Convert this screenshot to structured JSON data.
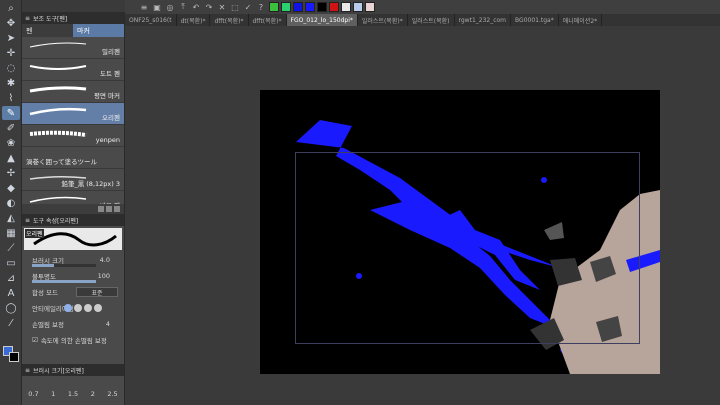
{
  "sub_tool": {
    "header": "보조 도구[펜]",
    "tabs": [
      "펜",
      "마커"
    ],
    "brushes": [
      {
        "name": "밀리펜"
      },
      {
        "name": "도트 펜"
      },
      {
        "name": "평면 마커"
      },
      {
        "name": "오리펜"
      },
      {
        "name": "yenpen"
      },
      {
        "name": "渦巻く囲って塗るツール"
      },
      {
        "name": "鉛筆_黒 (8,12px) 3"
      },
      {
        "name": "바끄 펜"
      }
    ]
  },
  "tool_property": {
    "header": "도구 속성[오리펜]",
    "preview_label": "오리펜",
    "brush_size_label": "브러시 크기",
    "brush_size_value": "4.0",
    "opacity_label": "불투명도",
    "opacity_value": "100",
    "opacity_fraction": 1.0,
    "brush_size_fraction": 0.35,
    "blend_label": "합성 모드",
    "blend_value": "표준",
    "antialias_label": "안티에일리어싱",
    "stabilization_label": "손떨림 보정",
    "stabilization_value": "4",
    "speed_label": "속도에 의한 손떨림 보정"
  },
  "brush_size_panel": {
    "header": "브러시 크기[오리펜]",
    "sizes": [
      "0.7",
      "1",
      "1.5",
      "2",
      "2.5"
    ]
  },
  "command_bar": {
    "colors": [
      "#3cbf3c",
      "#2bcf6e",
      "#1414e0",
      "#1a1aff",
      "#000000",
      "#d01414",
      "#e8e8e8",
      "#b8ccec",
      "#e8d4d4"
    ]
  },
  "document_tabs": [
    {
      "label": "ONF25_s016(t",
      "active": false
    },
    {
      "label": "dt(목환)*",
      "active": false
    },
    {
      "label": "dfft(목환)*",
      "active": false
    },
    {
      "label": "dfft(목환)*",
      "active": false
    },
    {
      "label": "FGO_012_lo_150dpi*",
      "active": true
    },
    {
      "label": "일러스트(목환)*",
      "active": false
    },
    {
      "label": "일러스트(목환)",
      "active": false
    },
    {
      "label": "rgwt1_232_com",
      "active": false
    },
    {
      "label": "BG0001.tga*",
      "active": false
    },
    {
      "label": "애니메이션2*",
      "active": false
    }
  ],
  "colors": {
    "accent": "#5c7da6",
    "canvas": "#000000",
    "paint_blue": "#1a1aff",
    "rock": "#b7a49a"
  }
}
